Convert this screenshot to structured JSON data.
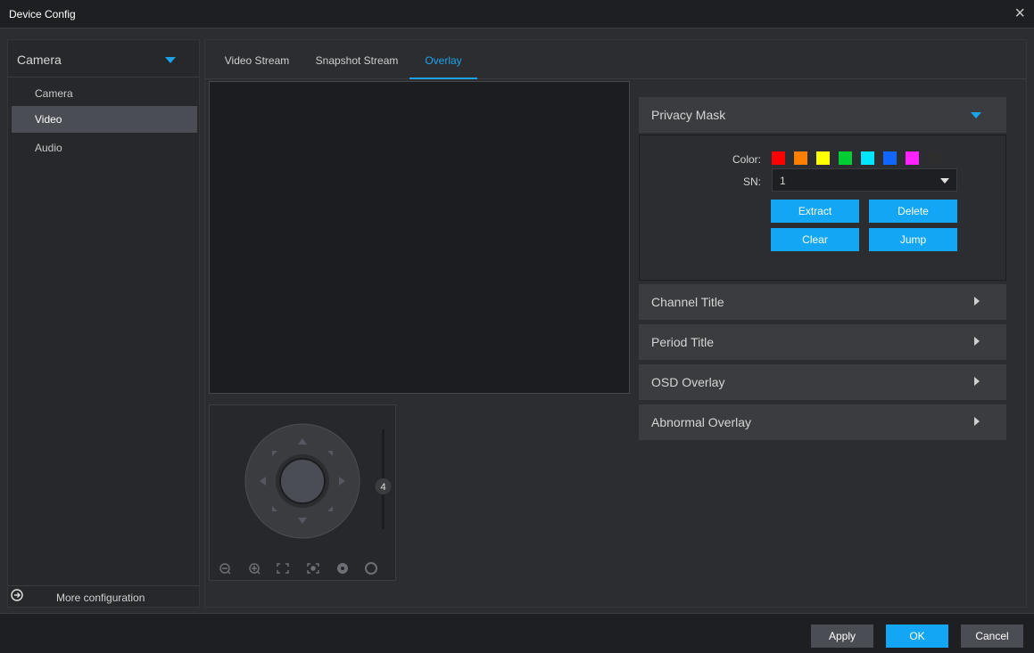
{
  "window": {
    "title": "Device Config",
    "close_glyph": "×"
  },
  "sidebar": {
    "dropdown_label": "Camera",
    "items": [
      {
        "label": "Camera",
        "active": false
      },
      {
        "label": "Video",
        "active": true
      },
      {
        "label": "Audio",
        "active": false
      }
    ],
    "more_label": "More configuration"
  },
  "tabs": [
    {
      "label": "Video Stream",
      "active": false
    },
    {
      "label": "Snapshot Stream",
      "active": false
    },
    {
      "label": "Overlay",
      "active": true
    }
  ],
  "ptz": {
    "speed_value": "4"
  },
  "privacy_mask": {
    "title": "Privacy Mask",
    "color_label": "Color:",
    "colors": [
      "#ff0000",
      "#ff7f00",
      "#ffff00",
      "#00cc33",
      "#00e5ff",
      "#1166ff",
      "#ff22ff",
      "#2e2e2e"
    ],
    "sn_label": "SN:",
    "sn_value": "1",
    "buttons": {
      "extract": "Extract",
      "delete": "Delete",
      "clear": "Clear",
      "jump": "Jump"
    }
  },
  "panels": [
    {
      "label": "Channel Title"
    },
    {
      "label": "Period Title"
    },
    {
      "label": "OSD Overlay"
    },
    {
      "label": "Abnormal Overlay"
    }
  ],
  "footer": {
    "apply": "Apply",
    "ok": "OK",
    "cancel": "Cancel"
  },
  "accent_color": "#1ba3ea"
}
